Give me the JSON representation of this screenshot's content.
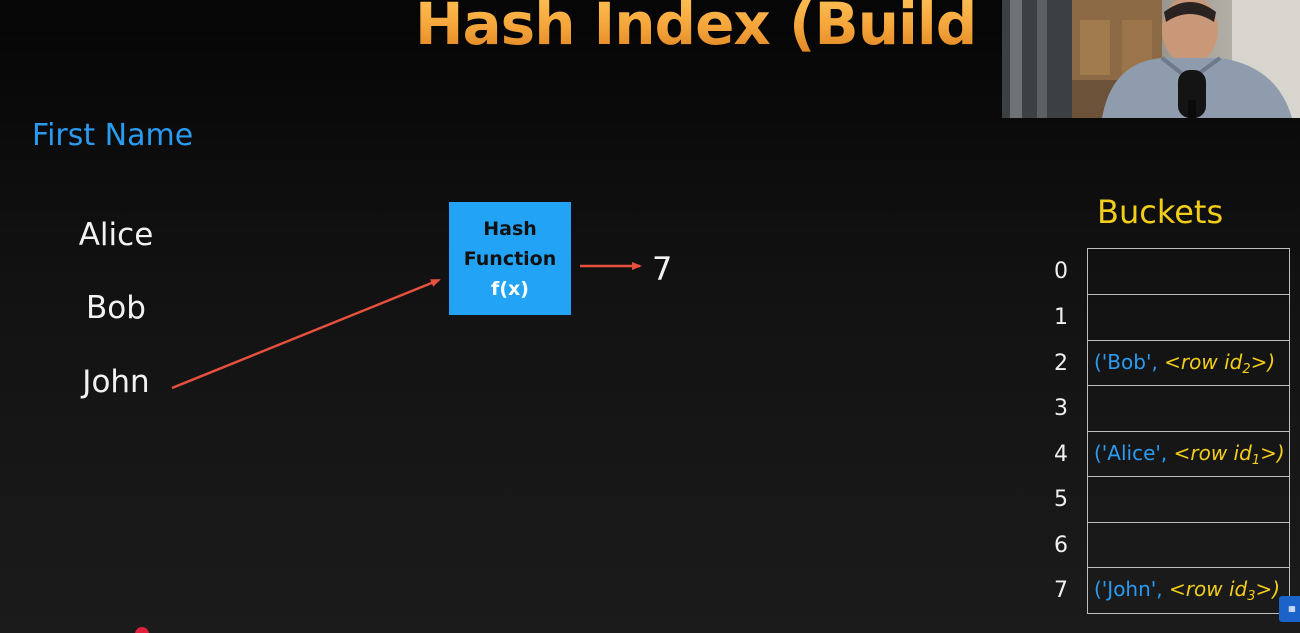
{
  "slide": {
    "title": "Hash Index (Build)",
    "section_label": "First Name",
    "names": [
      "Alice",
      "Bob",
      "John"
    ],
    "hash_function": {
      "line1": "Hash",
      "line2": "Function",
      "line3": "f(x)"
    },
    "hash_result": "7",
    "buckets_title": "Buckets",
    "buckets": [
      {
        "index": "0"
      },
      {
        "index": "1"
      },
      {
        "index": "2",
        "key": "('Bob',",
        "row": "<row id",
        "sub": "2",
        "close": ">)"
      },
      {
        "index": "3"
      },
      {
        "index": "4",
        "key": "('Alice',",
        "row": "<row id",
        "sub": "1",
        "close": ">)"
      },
      {
        "index": "5"
      },
      {
        "index": "6"
      },
      {
        "index": "7",
        "key": "('John',",
        "row": "<row id",
        "sub": "3",
        "close": ">)"
      }
    ]
  },
  "colors": {
    "title": "#f4a43a",
    "label_blue": "#2a9bf0",
    "bucket_yellow": "#f2cd1a",
    "hash_box": "#22a3f5",
    "arrow": "#e8503e"
  }
}
